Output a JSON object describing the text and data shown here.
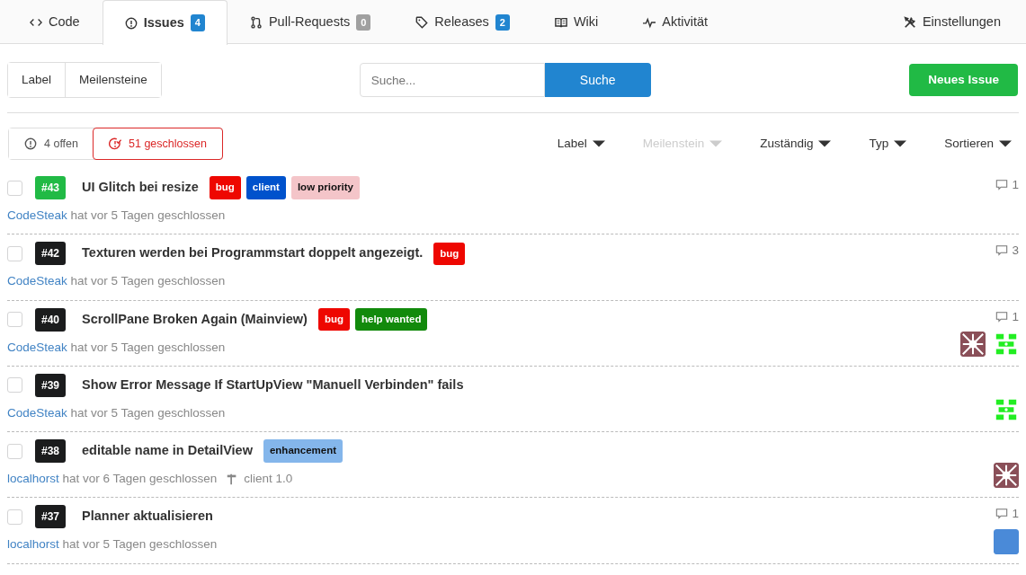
{
  "tabs": [
    {
      "kind": "code",
      "label": "Code",
      "selected": false
    },
    {
      "kind": "issue",
      "label": "Issues",
      "count": "4",
      "color": "#2185d0",
      "selected": true
    },
    {
      "kind": "pull",
      "label": "Pull-Requests",
      "count": "0",
      "color": "#a0a0a0",
      "selected": false
    },
    {
      "kind": "tag",
      "label": "Releases",
      "count": "2",
      "color": "#2185d0",
      "selected": false
    },
    {
      "kind": "book",
      "label": "Wiki",
      "selected": false
    },
    {
      "kind": "pulse",
      "label": "Aktivität",
      "selected": false
    }
  ],
  "settings_tab": {
    "label": "Einstellungen"
  },
  "toolbar": {
    "buttons": [
      "Label",
      "Meilensteine"
    ],
    "search": {
      "placeholder": "Suche..."
    },
    "search_button": "Suche",
    "new_issue": "Neues Issue"
  },
  "state_tabs": [
    {
      "kind": "open",
      "label": "4 offen",
      "selected": false
    },
    {
      "kind": "closed",
      "label": "51 geschlossen",
      "selected": true
    }
  ],
  "filters": [
    {
      "label": "Label",
      "disabled": false
    },
    {
      "label": "Meilenstein",
      "disabled": true
    },
    {
      "label": "Zuständig",
      "disabled": false
    },
    {
      "label": "Typ",
      "disabled": false
    },
    {
      "label": "Sortieren",
      "disabled": false
    }
  ],
  "issues": [
    {
      "checked": false,
      "number": "#43",
      "color": "#21ba45",
      "title": "UI Glitch bei resize",
      "labels": [
        {
          "text": "bug",
          "color": "#ee0701"
        },
        {
          "text": "client",
          "color": "#0052cc"
        },
        {
          "text": "low priority",
          "color": "#f4c5c9"
        }
      ],
      "author": "CodeSteak",
      "meta": "hat vor 5 Tagen geschlossen",
      "comments": "1"
    },
    {
      "checked": false,
      "number": "#42",
      "color": "#1b1c1d",
      "title": "Texturen werden bei Programmstart doppelt angezeigt.",
      "labels": [
        {
          "text": "bug",
          "color": "#ee0701"
        }
      ],
      "author": "CodeSteak",
      "meta": "hat vor 5 Tagen geschlossen",
      "comments": "3"
    },
    {
      "checked": false,
      "number": "#40",
      "color": "#1b1c1d",
      "title": "ScrollPane Broken Again (Mainview)",
      "labels": [
        {
          "text": "bug",
          "color": "#ee0701"
        },
        {
          "text": "help wanted",
          "color": "#128a0c"
        }
      ],
      "author": "CodeSteak",
      "meta": "hat vor 5 Tagen geschlossen",
      "comments": "1",
      "assignees": [
        {
          "kind": "identicon",
          "color": "#8a4f58"
        },
        {
          "kind": "identicon",
          "color": "#22ee22"
        }
      ]
    },
    {
      "checked": false,
      "number": "#39",
      "color": "#1b1c1d",
      "title": "Show Error Message If StartUpView \"Manuell Verbinden\" fails",
      "author": "CodeSteak",
      "meta": "hat vor 5 Tagen geschlossen",
      "assignees": [
        {
          "kind": "identicon",
          "color": "#22ee22"
        }
      ]
    },
    {
      "checked": false,
      "number": "#38",
      "color": "#1b1c1d",
      "title": "editable name in DetailView",
      "labels": [
        {
          "text": "enhancement",
          "color": "#84b6eb"
        }
      ],
      "author": "localhorst",
      "meta": "hat vor 6 Tagen geschlossen",
      "milestone": "client 1.0",
      "assignees": [
        {
          "kind": "identicon",
          "color": "#8a4f58"
        }
      ]
    },
    {
      "checked": false,
      "number": "#37",
      "color": "#1b1c1d",
      "title": "Planner aktualisieren",
      "author": "localhorst",
      "meta": "hat vor 5 Tagen geschlossen",
      "comments": "1",
      "assignees": [
        {
          "kind": "photo"
        }
      ]
    }
  ]
}
